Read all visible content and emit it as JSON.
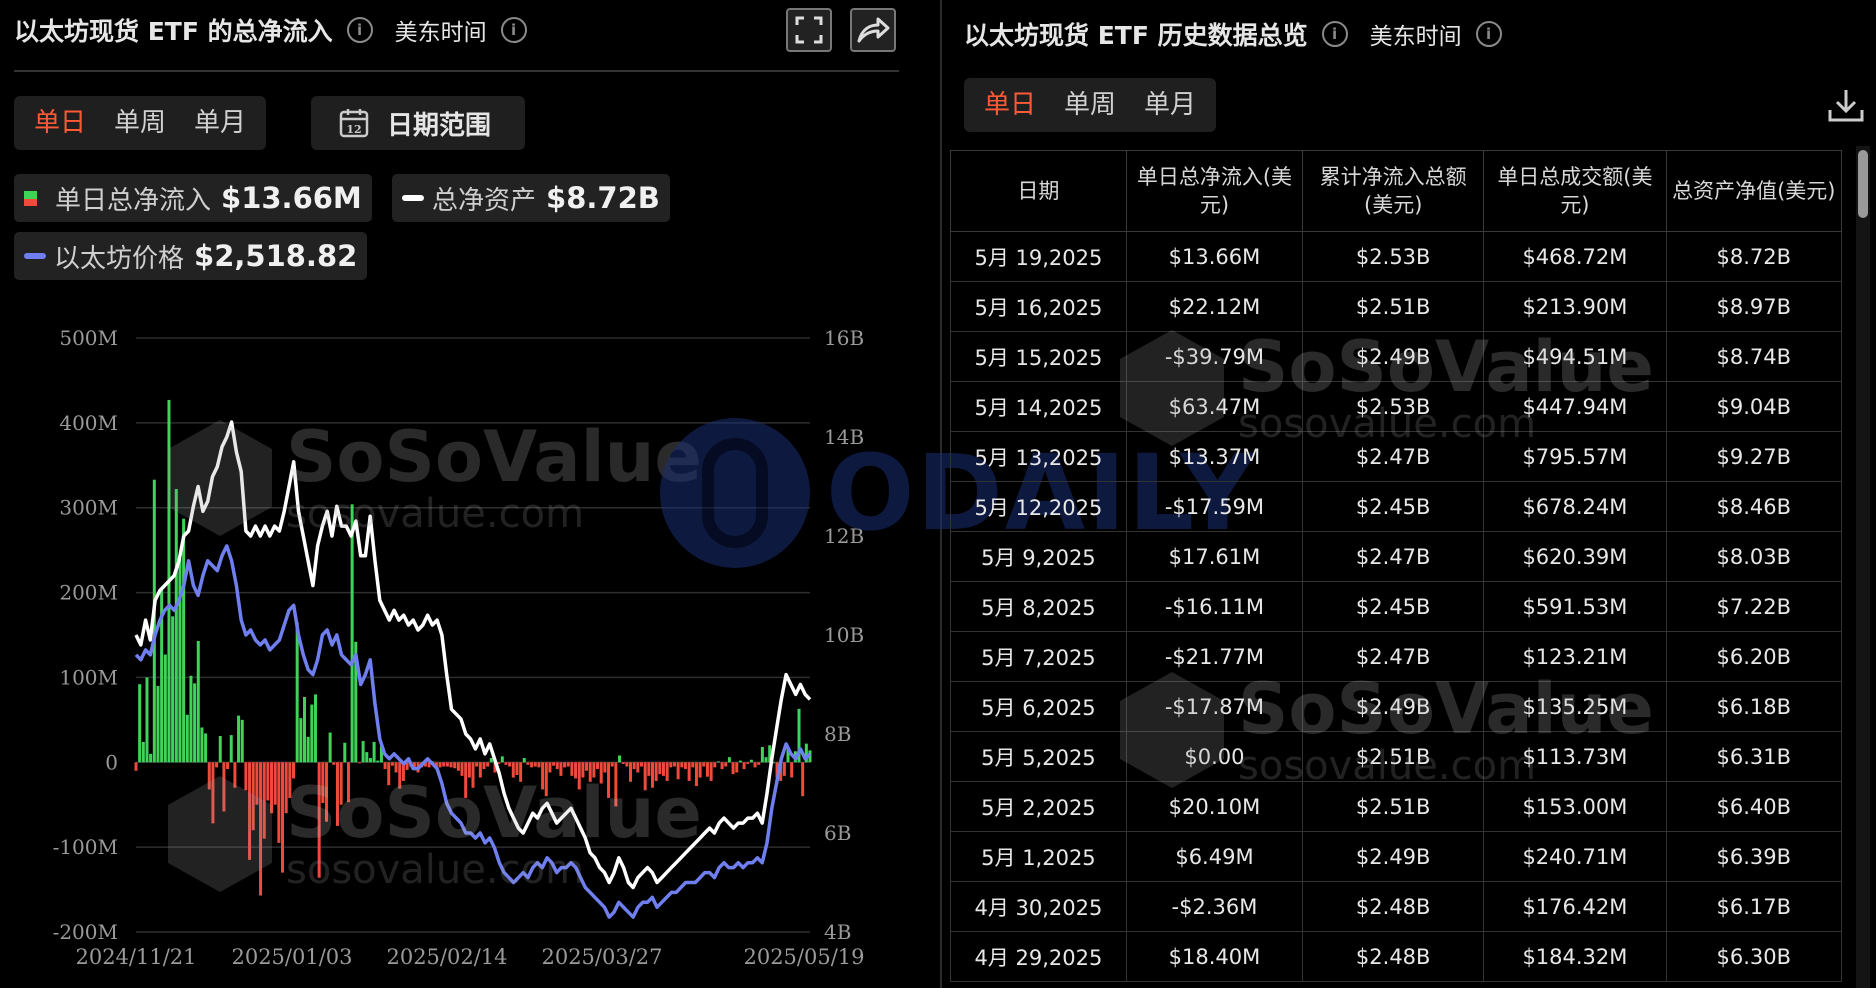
{
  "left": {
    "title": "以太坊现货 ETF 的总净流入",
    "timezone": "美东时间",
    "tabs": [
      "单日",
      "单周",
      "单月"
    ],
    "date_range_label": "日期范围",
    "calendar_day": "12",
    "legend": {
      "net_inflow_label": "单日总净流入",
      "net_inflow_value": "$13.66M",
      "net_assets_label": "总净资产",
      "net_assets_value": "$8.72B",
      "eth_price_label": "以太坊价格",
      "eth_price_value": "$2,518.82"
    }
  },
  "right": {
    "title": "以太坊现货 ETF 历史数据总览",
    "timezone": "美东时间",
    "tabs": [
      "单日",
      "单周",
      "单月"
    ],
    "columns": [
      "日期",
      "单日总净流入(美元)",
      "累计净流入总额(美元)",
      "单日总成交额(美元)",
      "总资产净值(美元)"
    ],
    "rows": [
      {
        "date": "5月 19,2025",
        "flow": "$13.66M",
        "sign": "pos",
        "cum": "$2.53B",
        "vol": "$468.72M",
        "nav": "$8.72B"
      },
      {
        "date": "5月 16,2025",
        "flow": "$22.12M",
        "sign": "pos",
        "cum": "$2.51B",
        "vol": "$213.90M",
        "nav": "$8.97B"
      },
      {
        "date": "5月 15,2025",
        "flow": "-$39.79M",
        "sign": "neg",
        "cum": "$2.49B",
        "vol": "$494.51M",
        "nav": "$8.74B"
      },
      {
        "date": "5月 14,2025",
        "flow": "$63.47M",
        "sign": "pos",
        "cum": "$2.53B",
        "vol": "$447.94M",
        "nav": "$9.04B"
      },
      {
        "date": "5月 13,2025",
        "flow": "$13.37M",
        "sign": "pos",
        "cum": "$2.47B",
        "vol": "$795.57M",
        "nav": "$9.27B"
      },
      {
        "date": "5月 12,2025",
        "flow": "-$17.59M",
        "sign": "neg",
        "cum": "$2.45B",
        "vol": "$678.24M",
        "nav": "$8.46B"
      },
      {
        "date": "5月 9,2025",
        "flow": "$17.61M",
        "sign": "pos",
        "cum": "$2.47B",
        "vol": "$620.39M",
        "nav": "$8.03B"
      },
      {
        "date": "5月 8,2025",
        "flow": "-$16.11M",
        "sign": "neg",
        "cum": "$2.45B",
        "vol": "$591.53M",
        "nav": "$7.22B"
      },
      {
        "date": "5月 7,2025",
        "flow": "-$21.77M",
        "sign": "neg",
        "cum": "$2.47B",
        "vol": "$123.21M",
        "nav": "$6.20B"
      },
      {
        "date": "5月 6,2025",
        "flow": "-$17.87M",
        "sign": "neg",
        "cum": "$2.49B",
        "vol": "$135.25M",
        "nav": "$6.18B"
      },
      {
        "date": "5月 5,2025",
        "flow": "$0.00",
        "sign": "zero",
        "cum": "$2.51B",
        "vol": "$113.73M",
        "nav": "$6.31B"
      },
      {
        "date": "5月 2,2025",
        "flow": "$20.10M",
        "sign": "pos",
        "cum": "$2.51B",
        "vol": "$153.00M",
        "nav": "$6.40B"
      },
      {
        "date": "5月 1,2025",
        "flow": "$6.49M",
        "sign": "pos",
        "cum": "$2.49B",
        "vol": "$240.71M",
        "nav": "$6.39B"
      },
      {
        "date": "4月 30,2025",
        "flow": "-$2.36M",
        "sign": "neg",
        "cum": "$2.48B",
        "vol": "$176.42M",
        "nav": "$6.17B"
      },
      {
        "date": "4月 29,2025",
        "flow": "$18.40M",
        "sign": "pos",
        "cum": "$2.48B",
        "vol": "$184.32M",
        "nav": "$6.30B"
      }
    ]
  },
  "watermarks": {
    "brand": "SoSoValue",
    "site": "sosovalue.com",
    "odaily": "ODAILY"
  },
  "colors": {
    "positive": "#3fd35a",
    "negative": "#ef4a3c",
    "net_assets_line": "#ffffff",
    "eth_price_line": "#6f7ff0",
    "accent": "#ff5a36"
  },
  "chart_data": {
    "type": "bar",
    "xlabel": "",
    "ylabel": "",
    "x_ticks": [
      "2024/11/21",
      "2025/01/03",
      "2025/02/14",
      "2025/03/27",
      "2025/05/19"
    ],
    "y_left_ticks": [
      "500M",
      "400M",
      "300M",
      "200M",
      "100M",
      "0",
      "-100M",
      "-200M"
    ],
    "y_right_ticks": [
      "16B",
      "14B",
      "12B",
      "10B",
      "8B",
      "6B",
      "4B"
    ],
    "ylim_left": [
      -200,
      500
    ],
    "ylim_right": [
      4,
      16
    ],
    "units_left": "M USD",
    "units_right": "B USD",
    "series": [
      {
        "name": "单日总净流入",
        "axis": "left",
        "kind": "bar",
        "values": [
          -10,
          92,
          24,
          100,
          10,
          333,
          90,
          205,
          127,
          427,
          172,
          322,
          240,
          287,
          56,
          102,
          93,
          143,
          41,
          34,
          -32,
          -72,
          -6,
          31,
          -58,
          -8,
          32,
          -30,
          55,
          50,
          -33,
          -115,
          -80,
          -50,
          -157,
          -90,
          -45,
          -60,
          -50,
          -95,
          -130,
          -60,
          -42,
          -19,
          165,
          52,
          77,
          30,
          68,
          80,
          -136,
          -48,
          -70,
          35,
          -3,
          -75,
          -50,
          23,
          -47,
          304,
          142,
          -1,
          25,
          12,
          5,
          24,
          2,
          19,
          -8,
          -27,
          -4,
          -12,
          -31,
          -22,
          -9,
          -5,
          -7,
          -12,
          -6,
          -5,
          -6,
          1,
          -8,
          -6,
          -5,
          -5,
          -6,
          -7,
          -10,
          -16,
          -42,
          -18,
          -30,
          -5,
          -18,
          -8,
          -5,
          5,
          -12,
          -2,
          7,
          -3,
          -5,
          -18,
          -15,
          -23,
          5,
          -3,
          -6,
          -5,
          -6,
          -32,
          -40,
          -12,
          -4,
          -8,
          -16,
          -6,
          -5,
          -16,
          -19,
          -32,
          -18,
          -10,
          -23,
          -18,
          -8,
          -25,
          -12,
          -42,
          -5,
          -52,
          8,
          -2,
          -5,
          -23,
          -8,
          -12,
          -5,
          -33,
          -16,
          -30,
          -22,
          -14,
          -16,
          -22,
          -6,
          -5,
          -20,
          -6,
          -8,
          -22,
          -6,
          -28,
          -18,
          -5,
          -17,
          -22,
          -6,
          1,
          -8,
          -5,
          6,
          -14,
          -12,
          2,
          -8,
          -2,
          3,
          -6,
          -3,
          18,
          6,
          20,
          0,
          -18,
          -22,
          -16,
          18,
          -18,
          13,
          63,
          -40,
          22,
          14
        ]
      },
      {
        "name": "总净资产",
        "axis": "right",
        "kind": "line",
        "values": [
          10.0,
          9.8,
          10.3,
          9.9,
          10.7,
          10.9,
          11.0,
          11.1,
          11.2,
          11.5,
          12.0,
          12.1,
          12.6,
          13.0,
          12.5,
          12.7,
          13.2,
          13.4,
          13.8,
          14.0,
          14.3,
          13.7,
          13.3,
          12.1,
          12.0,
          12.2,
          12.0,
          12.2,
          12.0,
          12.2,
          12.1,
          12.5,
          13.0,
          13.5,
          12.5,
          12.0,
          11.5,
          11.0,
          11.8,
          12.2,
          12.5,
          12.0,
          12.6,
          12.2,
          12.2,
          12.0,
          12.3,
          11.6,
          11.6,
          12.4,
          11.5,
          10.7,
          10.5,
          10.3,
          10.5,
          10.3,
          10.4,
          10.2,
          10.3,
          10.1,
          10.2,
          10.4,
          10.2,
          10.3,
          10.0,
          9.2,
          8.5,
          8.4,
          8.3,
          8.0,
          7.9,
          7.7,
          7.9,
          7.6,
          7.8,
          7.5,
          7.2,
          6.8,
          6.5,
          6.3,
          6.1,
          6.0,
          6.2,
          6.4,
          6.3,
          6.5,
          6.6,
          6.4,
          6.2,
          6.3,
          6.4,
          6.5,
          6.3,
          6.1,
          5.9,
          5.6,
          5.5,
          5.3,
          5.2,
          5.0,
          5.2,
          5.5,
          5.3,
          5.0,
          4.9,
          5.1,
          5.2,
          5.3,
          5.2,
          5.0,
          5.1,
          5.2,
          5.3,
          5.4,
          5.5,
          5.6,
          5.7,
          5.8,
          5.9,
          6.0,
          6.1,
          6.0,
          6.2,
          6.3,
          6.2,
          6.1,
          6.2,
          6.2,
          6.3,
          6.3,
          6.4,
          6.2,
          6.8,
          7.5,
          8.1,
          8.7,
          9.2,
          9.0,
          8.8,
          9.0,
          8.8,
          8.7
        ]
      },
      {
        "name": "以太坊价格",
        "axis": "right",
        "kind": "line",
        "values": [
          9.6,
          9.5,
          9.7,
          9.6,
          10.0,
          10.3,
          10.5,
          10.6,
          10.5,
          10.7,
          11.0,
          11.5,
          11.0,
          10.8,
          11.2,
          11.5,
          11.4,
          11.3,
          11.6,
          11.8,
          11.5,
          11.0,
          10.3,
          10.0,
          10.1,
          9.9,
          9.8,
          9.9,
          9.7,
          9.8,
          9.9,
          10.2,
          10.5,
          10.6,
          10.0,
          9.6,
          9.3,
          9.2,
          9.5,
          10.0,
          10.1,
          9.8,
          10.0,
          9.6,
          9.5,
          9.4,
          9.6,
          9.0,
          9.2,
          9.5,
          8.6,
          7.9,
          7.6,
          7.5,
          7.6,
          7.5,
          7.4,
          7.5,
          7.3,
          7.3,
          7.4,
          7.5,
          7.4,
          7.3,
          7.0,
          6.6,
          6.4,
          6.3,
          6.2,
          6.0,
          6.0,
          5.9,
          6.0,
          5.8,
          5.9,
          5.7,
          5.4,
          5.2,
          5.1,
          5.0,
          5.1,
          5.2,
          5.1,
          5.3,
          5.4,
          5.3,
          5.5,
          5.4,
          5.2,
          5.3,
          5.3,
          5.4,
          5.3,
          5.1,
          4.9,
          4.8,
          4.7,
          4.6,
          4.5,
          4.3,
          4.4,
          4.6,
          4.5,
          4.4,
          4.3,
          4.5,
          4.6,
          4.6,
          4.7,
          4.5,
          4.6,
          4.7,
          4.8,
          4.8,
          4.9,
          5.0,
          5.0,
          5.0,
          5.1,
          5.2,
          5.2,
          5.1,
          5.3,
          5.4,
          5.3,
          5.3,
          5.4,
          5.3,
          5.4,
          5.4,
          5.5,
          5.4,
          5.8,
          6.5,
          7.0,
          7.5,
          7.8,
          7.6,
          7.5,
          7.7,
          7.5,
          7.6
        ]
      }
    ]
  }
}
